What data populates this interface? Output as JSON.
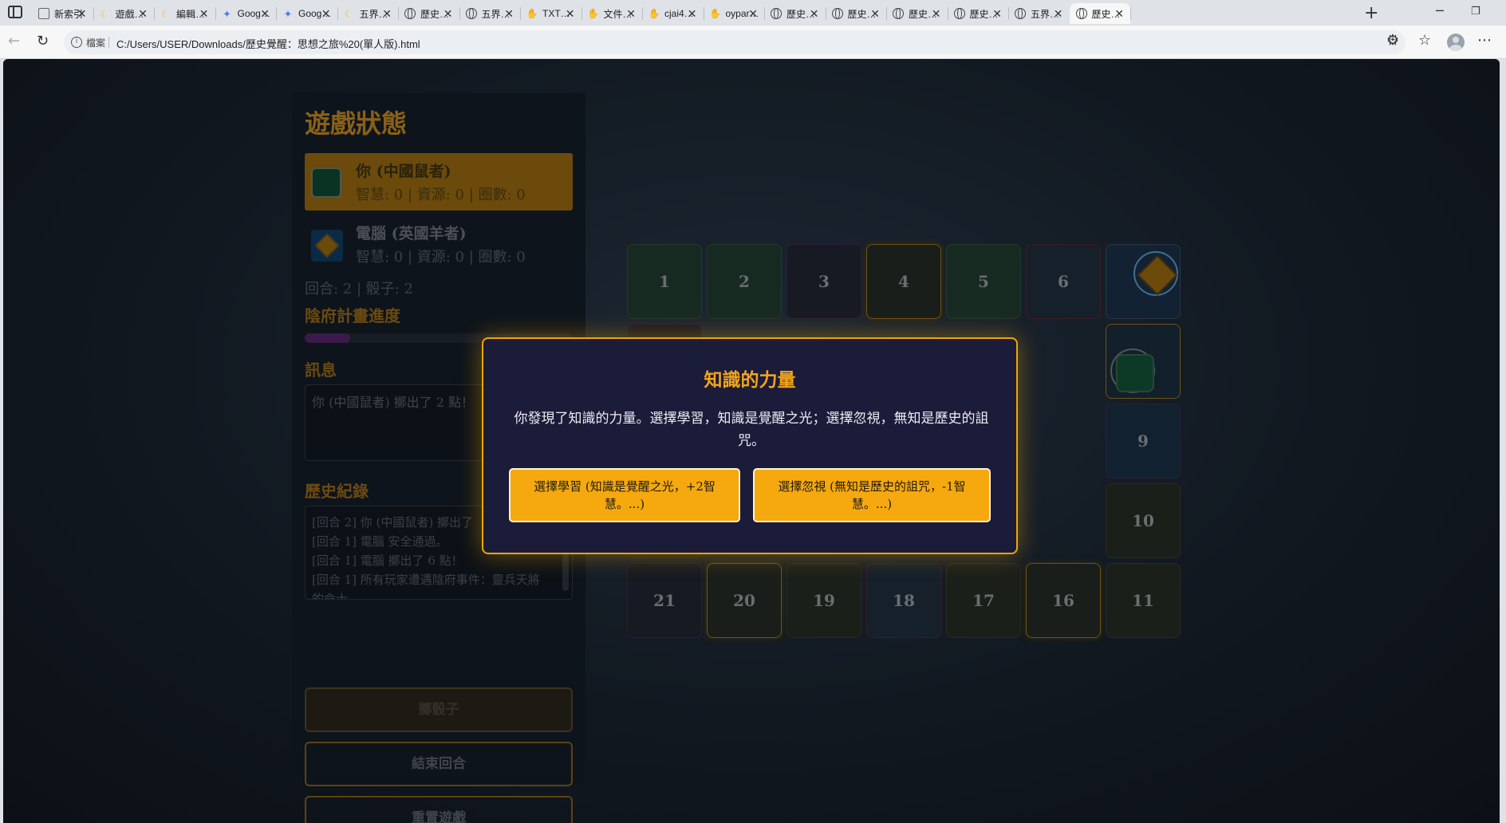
{
  "browser": {
    "tabs": [
      {
        "title": "新索引",
        "icon": "doc"
      },
      {
        "title": "遊戲…",
        "icon": "moon"
      },
      {
        "title": "編輯…",
        "icon": "moon"
      },
      {
        "title": "Goog…",
        "icon": "gem"
      },
      {
        "title": "Goog…",
        "icon": "gem"
      },
      {
        "title": "五界…",
        "icon": "moon"
      },
      {
        "title": "歷史…",
        "icon": "globe"
      },
      {
        "title": "五界…",
        "icon": "globe"
      },
      {
        "title": "TXT…",
        "icon": "hand"
      },
      {
        "title": "文件…",
        "icon": "hand"
      },
      {
        "title": "cjai4…",
        "icon": "hand"
      },
      {
        "title": "oypar…",
        "icon": "hand"
      },
      {
        "title": "歷史…",
        "icon": "globe"
      },
      {
        "title": "歷史…",
        "icon": "globe"
      },
      {
        "title": "歷史…",
        "icon": "globe"
      },
      {
        "title": "歷史…",
        "icon": "globe"
      },
      {
        "title": "五界…",
        "icon": "globe"
      },
      {
        "title": "歷史…",
        "icon": "globe"
      }
    ],
    "file_label": "檔案",
    "url": "C:/Users/USER/Downloads/歷史覺醒：思想之旅%20(單人版).html"
  },
  "panel": {
    "title": "遊戲狀態",
    "player": {
      "name": "你 (中國鼠者)",
      "stats": "智慧: 0 | 資源: 0 | 圈數: 0"
    },
    "cpu": {
      "name": "電腦 (英國羊者)",
      "stats": "智慧: 0 | 資源: 0 | 圈數: 0"
    },
    "round_info": "回合: 2 | 骰子: 2",
    "plan_heading": "陰府計畫進度",
    "plan_progress": 0.17,
    "message_heading": "訊息",
    "message": "你 (中國鼠者) 擲出了 2 點！",
    "history_heading": "歷史紀錄",
    "history": [
      "[回合 2] 你 (中國鼠者) 擲出了",
      "[回合 1] 電腦 安全通過。",
      "[回合 1] 電腦 擲出了 6 點！",
      "[回合 1] 所有玩家遭遇陰府事件：靈兵天將",
      "的命士。"
    ],
    "btn_roll": "擲骰子",
    "btn_end": "結束回合",
    "btn_reset": "重置遊戲"
  },
  "board": {
    "top": [
      "1",
      "2",
      "3",
      "4",
      "5",
      "6",
      ""
    ],
    "right": [
      "",
      "9",
      "10"
    ],
    "bottom": [
      "21",
      "20",
      "19",
      "18",
      "17",
      "16",
      "11"
    ]
  },
  "modal": {
    "title": "知識的力量",
    "text": "你發現了知識的力量。選擇學習，知識是覺醒之光；選擇忽視，無知是歷史的詛咒。",
    "btn_learn": "選擇學習 (知識是覺醒之光，+2智慧。...)",
    "btn_ignore": "選擇忽視 (無知是歷史的詛咒，-1智慧。...)"
  }
}
